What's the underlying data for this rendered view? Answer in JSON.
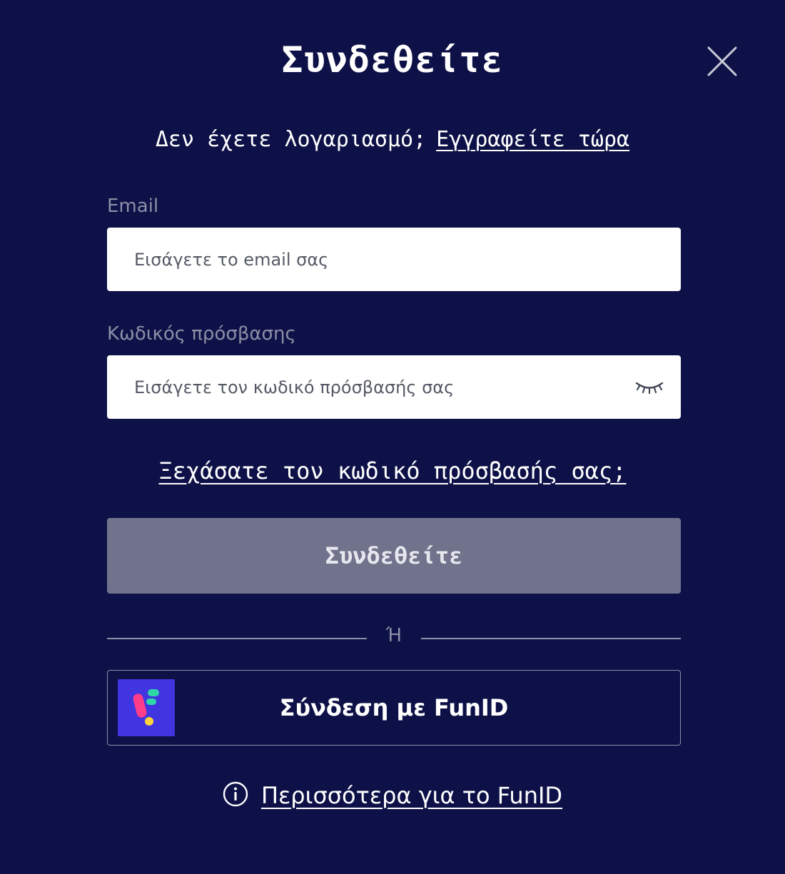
{
  "dialog": {
    "title": "Συνδεθείτε",
    "close_icon": "close-icon"
  },
  "signup": {
    "question": "Δεν έχετε λογαριασμό;",
    "link": "Εγγραφείτε τώρα"
  },
  "email": {
    "label": "Email",
    "placeholder": "Εισάγετε το email σας",
    "value": ""
  },
  "password": {
    "label": "Κωδικός πρόσβασης",
    "placeholder": "Εισάγετε τον κωδικό πρόσβασής σας",
    "value": "",
    "toggle_icon": "eye-closed-icon"
  },
  "forgot": {
    "link": "Ξεχάσατε τον κωδικό πρόσβασής σας;"
  },
  "login_button": {
    "label": "Συνδεθείτε"
  },
  "divider": {
    "text": "Ή"
  },
  "funid": {
    "label": "Σύνδεση με FunID",
    "logo_icon": "funid-logo-icon",
    "logo_color": "#4035e0"
  },
  "more": {
    "icon": "info-icon",
    "link": "Περισσότερα για το FunID"
  },
  "colors": {
    "background": "#0e1147",
    "button_disabled": "#70738b",
    "muted_text": "#8c8fa6"
  }
}
